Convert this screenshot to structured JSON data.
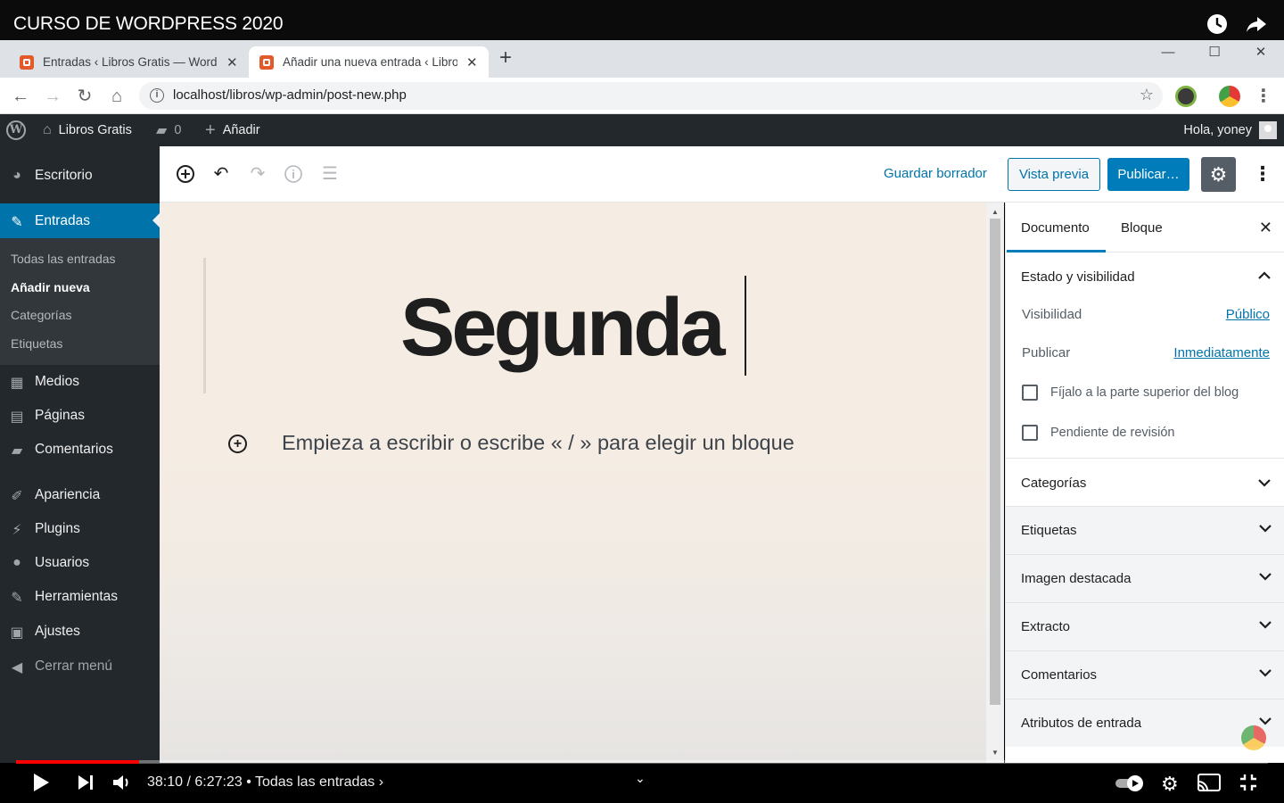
{
  "video": {
    "title": "CURSO DE WORDPRESS 2020",
    "time": "38:10 / 6:27:23",
    "chapter": "• Todas las entradas ›",
    "progress_fraction": 0.098
  },
  "browser": {
    "tabs": [
      {
        "label": "Entradas ‹ Libros Gratis — WordPress"
      },
      {
        "label": "Añadir una nueva entrada ‹ Libros Gratis"
      }
    ],
    "url": "localhost/libros/wp-admin/post-new.php"
  },
  "adminbar": {
    "site_name": "Libros Gratis",
    "comments_count": "0",
    "add_new": "Añadir",
    "greeting": "Hola, yoney"
  },
  "sidebar": {
    "dashboard": "Escritorio",
    "posts": "Entradas",
    "posts_sub": [
      "Todas las entradas",
      "Añadir nueva",
      "Categorías",
      "Etiquetas"
    ],
    "media": "Medios",
    "pages": "Páginas",
    "comments": "Comentarios",
    "appearance": "Apariencia",
    "plugins": "Plugins",
    "users": "Usuarios",
    "tools": "Herramientas",
    "settings": "Ajustes",
    "collapse": "Cerrar menú"
  },
  "toolbar": {
    "save_draft": "Guardar borrador",
    "preview": "Vista previa",
    "publish": "Publicar…"
  },
  "editor": {
    "title": "Segunda",
    "placeholder": "Empieza a escribir o escribe « / » para elegir un bloque"
  },
  "panel": {
    "tab_document": "Documento",
    "tab_block": "Bloque",
    "status_title": "Estado y visibilidad",
    "visibility_label": "Visibilidad",
    "visibility_value": "Público",
    "publish_label": "Publicar",
    "publish_value": "Inmediatamente",
    "sticky_label": "Fíjalo a la parte superior del blog",
    "pending_label": "Pendiente de revisión",
    "sections": [
      "Categorías",
      "Etiquetas",
      "Imagen destacada",
      "Extracto",
      "Comentarios",
      "Atributos de entrada"
    ]
  },
  "colors": {
    "wp_blue": "#007cba",
    "admin_dark": "#23282d",
    "yt_red": "#ff0000"
  }
}
